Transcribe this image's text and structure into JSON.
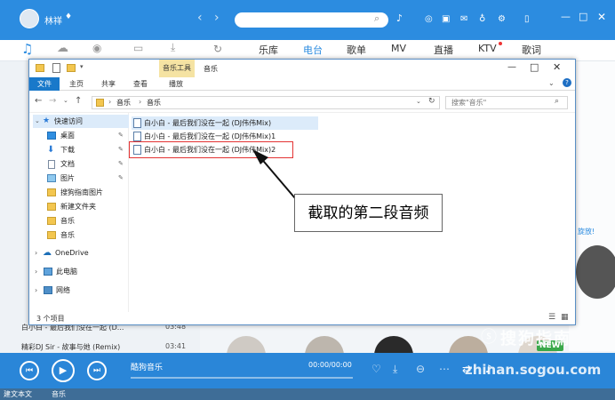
{
  "app": {
    "user_name": "林祥",
    "nav_tabs": [
      {
        "label": "乐库",
        "active": false
      },
      {
        "label": "电台",
        "active": true
      },
      {
        "label": "歌单",
        "active": false
      },
      {
        "label": "MV",
        "active": false
      },
      {
        "label": "直播",
        "active": false
      },
      {
        "label": "KTV",
        "active": false
      },
      {
        "label": "歌词",
        "active": false
      }
    ],
    "list_songs": [
      {
        "title": "白小白 - 最后我们没在一起 (D...",
        "duration": "03:48"
      },
      {
        "title": "精彩DJ Sir - 故事与她 (Remix)",
        "duration": "03:41"
      }
    ],
    "right_partial_text": "旋放!",
    "player": {
      "track_name": "酷狗音乐",
      "time": "00:00/00:00"
    },
    "watermark": "搜狗指南",
    "watermark_url": "zhinan.sogou.com",
    "new_badge": "NEW",
    "taskbar": [
      {
        "label": "建文本文"
      },
      {
        "label": "音乐"
      }
    ],
    "colors": {
      "brand_blue": "#2c8ce0",
      "file_tab_blue": "#1979ca",
      "highlight_red": "#e33333"
    }
  },
  "explorer": {
    "title": "音乐",
    "context_tab": "音乐工具",
    "ribbon_tabs": [
      "文件",
      "主页",
      "共享",
      "查看",
      "播放"
    ],
    "path": [
      "音乐",
      "音乐"
    ],
    "search_placeholder": "搜索\"音乐\"",
    "nav_items": [
      {
        "label": "快速访问",
        "icon": "star-icon",
        "pinned": false
      },
      {
        "label": "桌面",
        "icon": "desktop-icon",
        "pinned": true
      },
      {
        "label": "下载",
        "icon": "download-icon",
        "pinned": true
      },
      {
        "label": "文档",
        "icon": "document-icon",
        "pinned": true
      },
      {
        "label": "图片",
        "icon": "picture-icon",
        "pinned": true
      },
      {
        "label": "搜狗指南图片",
        "icon": "folder-icon",
        "pinned": false
      },
      {
        "label": "新建文件夹",
        "icon": "folder-icon",
        "pinned": false
      },
      {
        "label": "音乐",
        "icon": "folder-icon",
        "pinned": false
      },
      {
        "label": "音乐",
        "icon": "folder-icon",
        "pinned": false
      },
      {
        "label": "OneDrive",
        "icon": "cloud-icon",
        "pinned": false
      },
      {
        "label": "此电脑",
        "icon": "computer-icon",
        "pinned": false
      },
      {
        "label": "网络",
        "icon": "network-icon",
        "pinned": false
      }
    ],
    "files": [
      {
        "name": "白小白 - 最后我们没在一起 (DJ伟伟Mix)",
        "selected": true
      },
      {
        "name": "白小白 - 最后我们没在一起 (DJ伟伟Mix)1",
        "selected": false
      },
      {
        "name": "白小白 - 最后我们没在一起 (DJ伟伟Mix)2",
        "selected": false,
        "highlighted": true
      }
    ],
    "status_text": "3 个项目"
  },
  "annotation": {
    "callout_text": "截取的第二段音频"
  }
}
